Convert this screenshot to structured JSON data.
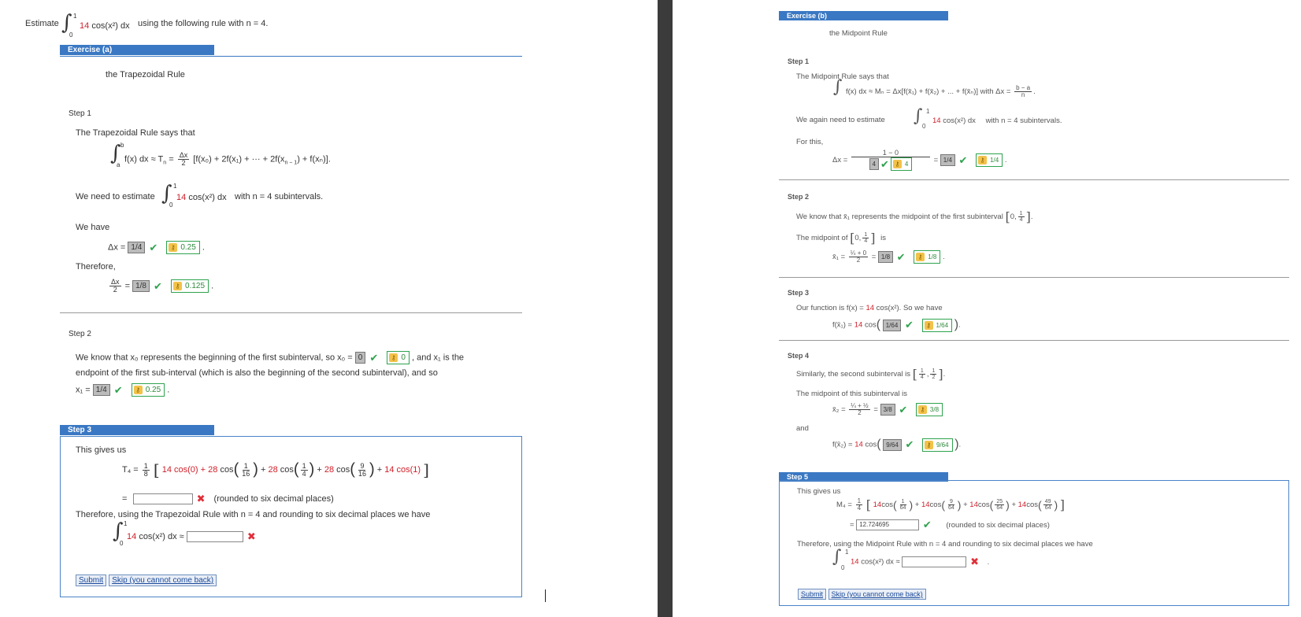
{
  "left": {
    "intro": {
      "estimate": "Estimate",
      "integrand_coef": "14",
      "integrand_fn": "cos(x²) dx",
      "suffix": "using the following rule with n = 4.",
      "lower": "0",
      "upper": "1"
    },
    "exercise_a": {
      "header": "Exercise (a)",
      "rule_name": "the Trapezoidal Rule",
      "step1": {
        "title": "Step 1",
        "says": "The Trapezoidal Rule says that",
        "formula_lhs": "f(x) dx ≈ T",
        "formula_sub": "n",
        "formula_eq": "=",
        "frac_num": "Δx",
        "frac_den": "2",
        "formula_rhs": "[f(x₀) + 2f(x₁) + ··· + 2f(x",
        "formula_rhs_sub": "n − 1",
        "formula_end": ") + f(xₙ)].",
        "lim_a": "a",
        "lim_b": "b",
        "need": "We need to estimate",
        "need_coef": "14",
        "need_fn": "cos(x²) dx",
        "need_suffix": "with n = 4 subintervals.",
        "we_have": "We have",
        "dx_label": "Δx =",
        "dx_answer": "1/4",
        "dx_key": "0.25",
        "therefore": "Therefore,",
        "half_num": "Δx",
        "half_den": "2",
        "half_eq": "=",
        "half_answer": "1/8",
        "half_key": "0.125"
      },
      "step2": {
        "title": "Step 2",
        "line1_a": "We know that",
        "line1_x0": "x₀",
        "line1_b": "represents the beginning of the first subinterval, so",
        "x0_eq": "x₀ =",
        "x0_answer": "0",
        "x0_key": "0",
        "line1_c": ", and x₁ is the",
        "line2": "endpoint of the first sub-interval (which is also the beginning of the second subinterval), and so",
        "x1_eq": "x₁ =",
        "x1_answer": "1/4",
        "x1_key": "0.25"
      },
      "step3": {
        "header": "Step 3",
        "gives": "This gives us",
        "t4": "T₄ =",
        "f_num": "1",
        "f_den": "8",
        "t1": "14 cos(0) +",
        "t2c": "28",
        "t2": "cos",
        "t2n": "1",
        "t2d": "16",
        "t3c": "28",
        "t3": "cos",
        "t3n": "1",
        "t3d": "4",
        "t4c": "28",
        "t4fn": "cos",
        "t4n": "9",
        "t4d": "16",
        "t5": "14 cos(1)",
        "eq": "=",
        "rounded": "(rounded to six decimal places)",
        "therefore": "Therefore, using the Trapezoidal Rule with n = 4 and rounding to six decimal places we have",
        "final_coef": "14",
        "final_fn": "cos(x²) dx ≈",
        "submit": "Submit",
        "skip": "Skip (you cannot come back)"
      }
    }
  },
  "right": {
    "exercise_b": {
      "header": "Exercise (b)",
      "rule_name": "the Midpoint Rule",
      "step1": {
        "title": "Step 1",
        "says": "The Midpoint Rule says that",
        "formula": "f(x) dx ≈ Mₙ = Δx[f(x̄₁) + f(x̄₂) + ... + f(x̄ₙ)]  with  Δx =",
        "frac_num": "b − a",
        "frac_den": "n",
        "again": "We again need to estimate",
        "again_coef": "14",
        "again_fn": "cos(x²) dx",
        "again_suffix": "with  n = 4  subintervals.",
        "for_this": "For this,",
        "dx_label": "Δx =",
        "dx_num": "1 − 0",
        "dx_den_answer": "4",
        "dx_den_key": "4",
        "dx_eq": "=",
        "dx_answer": "1/4",
        "dx_key": "1/4"
      },
      "step2": {
        "title": "Step 2",
        "know": "We know that  x̄₁  represents the midpoint of the first subinterval",
        "interval": "0,",
        "iv_n": "1",
        "iv_d": "4",
        "midpoint_of": "The midpoint of",
        "is": "is",
        "x1_label": "x̄₁ =",
        "x1_num": "¼ + 0",
        "x1_den": "2",
        "x1_eq": "=",
        "x1_answer": "1/8",
        "x1_key": "1/8"
      },
      "step3": {
        "title": "Step 3",
        "fn_text": "Our function is  f(x) =",
        "fn_coef": "14",
        "fn_rest": "cos(x²).  So we have",
        "fx1": "f(x̄₁) =",
        "fx1_coef": "14",
        "fx1_cos": "cos",
        "fx1_answer": "1/64",
        "fx1_key": "1/64"
      },
      "step4": {
        "title": "Step 4",
        "similarly": "Similarly, the second subinterval is",
        "mid_text": "The midpoint of this subinterval is",
        "x2_label": "x̄₂ =",
        "x2_num": "¼ + ½",
        "x2_den": "2",
        "x2_eq": "=",
        "x2_answer": "3/8",
        "x2_key": "3/8",
        "and": "and",
        "fx2": "f(x̄₂) =",
        "fx2_coef": "14",
        "fx2_cos": "cos",
        "fx2_answer": "9/64",
        "fx2_key": "9/64"
      },
      "step5": {
        "header": "Step 5",
        "gives": "This gives us",
        "m4": "M₄ =",
        "f_num": "1",
        "f_den": "4",
        "terms": [
          {
            "coef": "14",
            "fn": "cos",
            "n": "1",
            "d": "64"
          },
          {
            "coef": "14",
            "fn": "cos",
            "n": "9",
            "d": "64"
          },
          {
            "coef": "14",
            "fn": "cos",
            "n": "25",
            "d": "64"
          },
          {
            "coef": "14",
            "fn": "cos",
            "n": "49",
            "d": "64"
          }
        ],
        "eq": "=",
        "value": "12.724695",
        "rounded": "(rounded to six decimal places)",
        "therefore": "Therefore, using the Midpoint Rule with n = 4 and rounding to six decimal places we have",
        "final_coef": "14",
        "final_fn": "cos(x²) dx ≈",
        "submit": "Submit",
        "skip": "Skip (you cannot come back)"
      }
    }
  }
}
